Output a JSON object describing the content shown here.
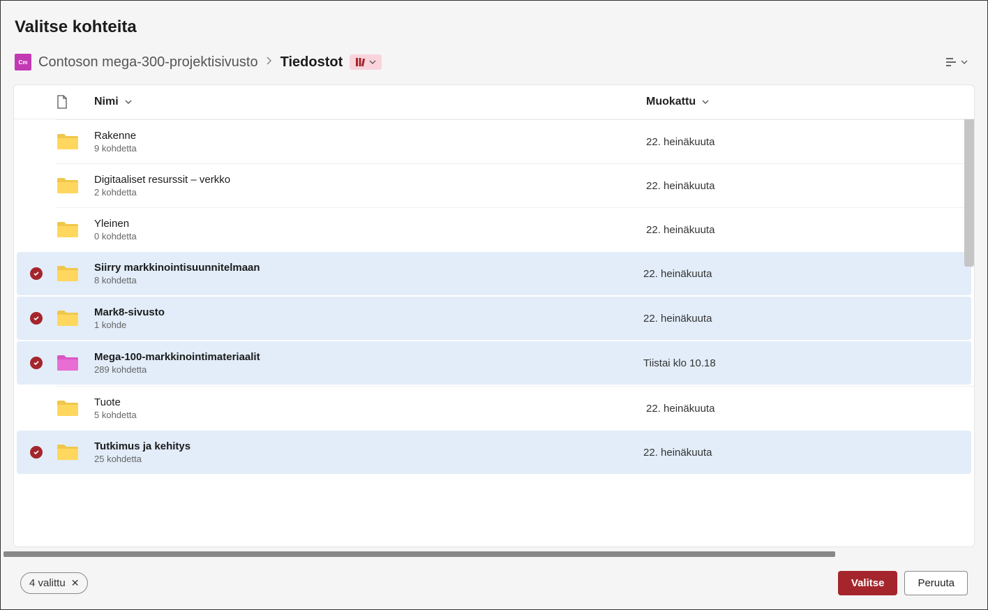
{
  "dialog": {
    "title": "Valitse kohteita"
  },
  "breadcrumb": {
    "site_icon_text": "Cm",
    "site": "Contoson mega-300-projektisivusto",
    "current": "Tiedostot"
  },
  "columns": {
    "name": "Nimi",
    "modified": "Muokattu"
  },
  "items": [
    {
      "name": "Rakenne",
      "meta": "9 kohdetta",
      "modified": "22. heinäkuuta",
      "selected": false,
      "color": "yellow"
    },
    {
      "name": "Digitaaliset resurssit – verkko",
      "meta": "2 kohdetta",
      "modified": "22. heinäkuuta",
      "selected": false,
      "color": "yellow"
    },
    {
      "name": "Yleinen",
      "meta": "0 kohdetta",
      "modified": "22. heinäkuuta",
      "selected": false,
      "color": "yellow"
    },
    {
      "name": "Siirry markkinointisuunnitelmaan",
      "meta": "8 kohdetta",
      "modified": "22. heinäkuuta",
      "selected": true,
      "color": "yellow"
    },
    {
      "name": "Mark8-sivusto",
      "meta": "1 kohde",
      "modified": "22. heinäkuuta",
      "selected": true,
      "color": "yellow"
    },
    {
      "name": "Mega-100-markkinointimateriaalit",
      "meta": "289 kohdetta",
      "modified": "Tiistai klo 10.18",
      "selected": true,
      "color": "pink"
    },
    {
      "name": "Tuote",
      "meta": "5 kohdetta",
      "modified": "22. heinäkuuta",
      "selected": false,
      "color": "yellow"
    },
    {
      "name": "Tutkimus ja kehitys",
      "meta": "25 kohdetta",
      "modified": "22. heinäkuuta",
      "selected": true,
      "color": "yellow"
    }
  ],
  "footer": {
    "selection_text": "4 valittu",
    "select_button": "Valitse",
    "cancel_button": "Peruuta"
  }
}
